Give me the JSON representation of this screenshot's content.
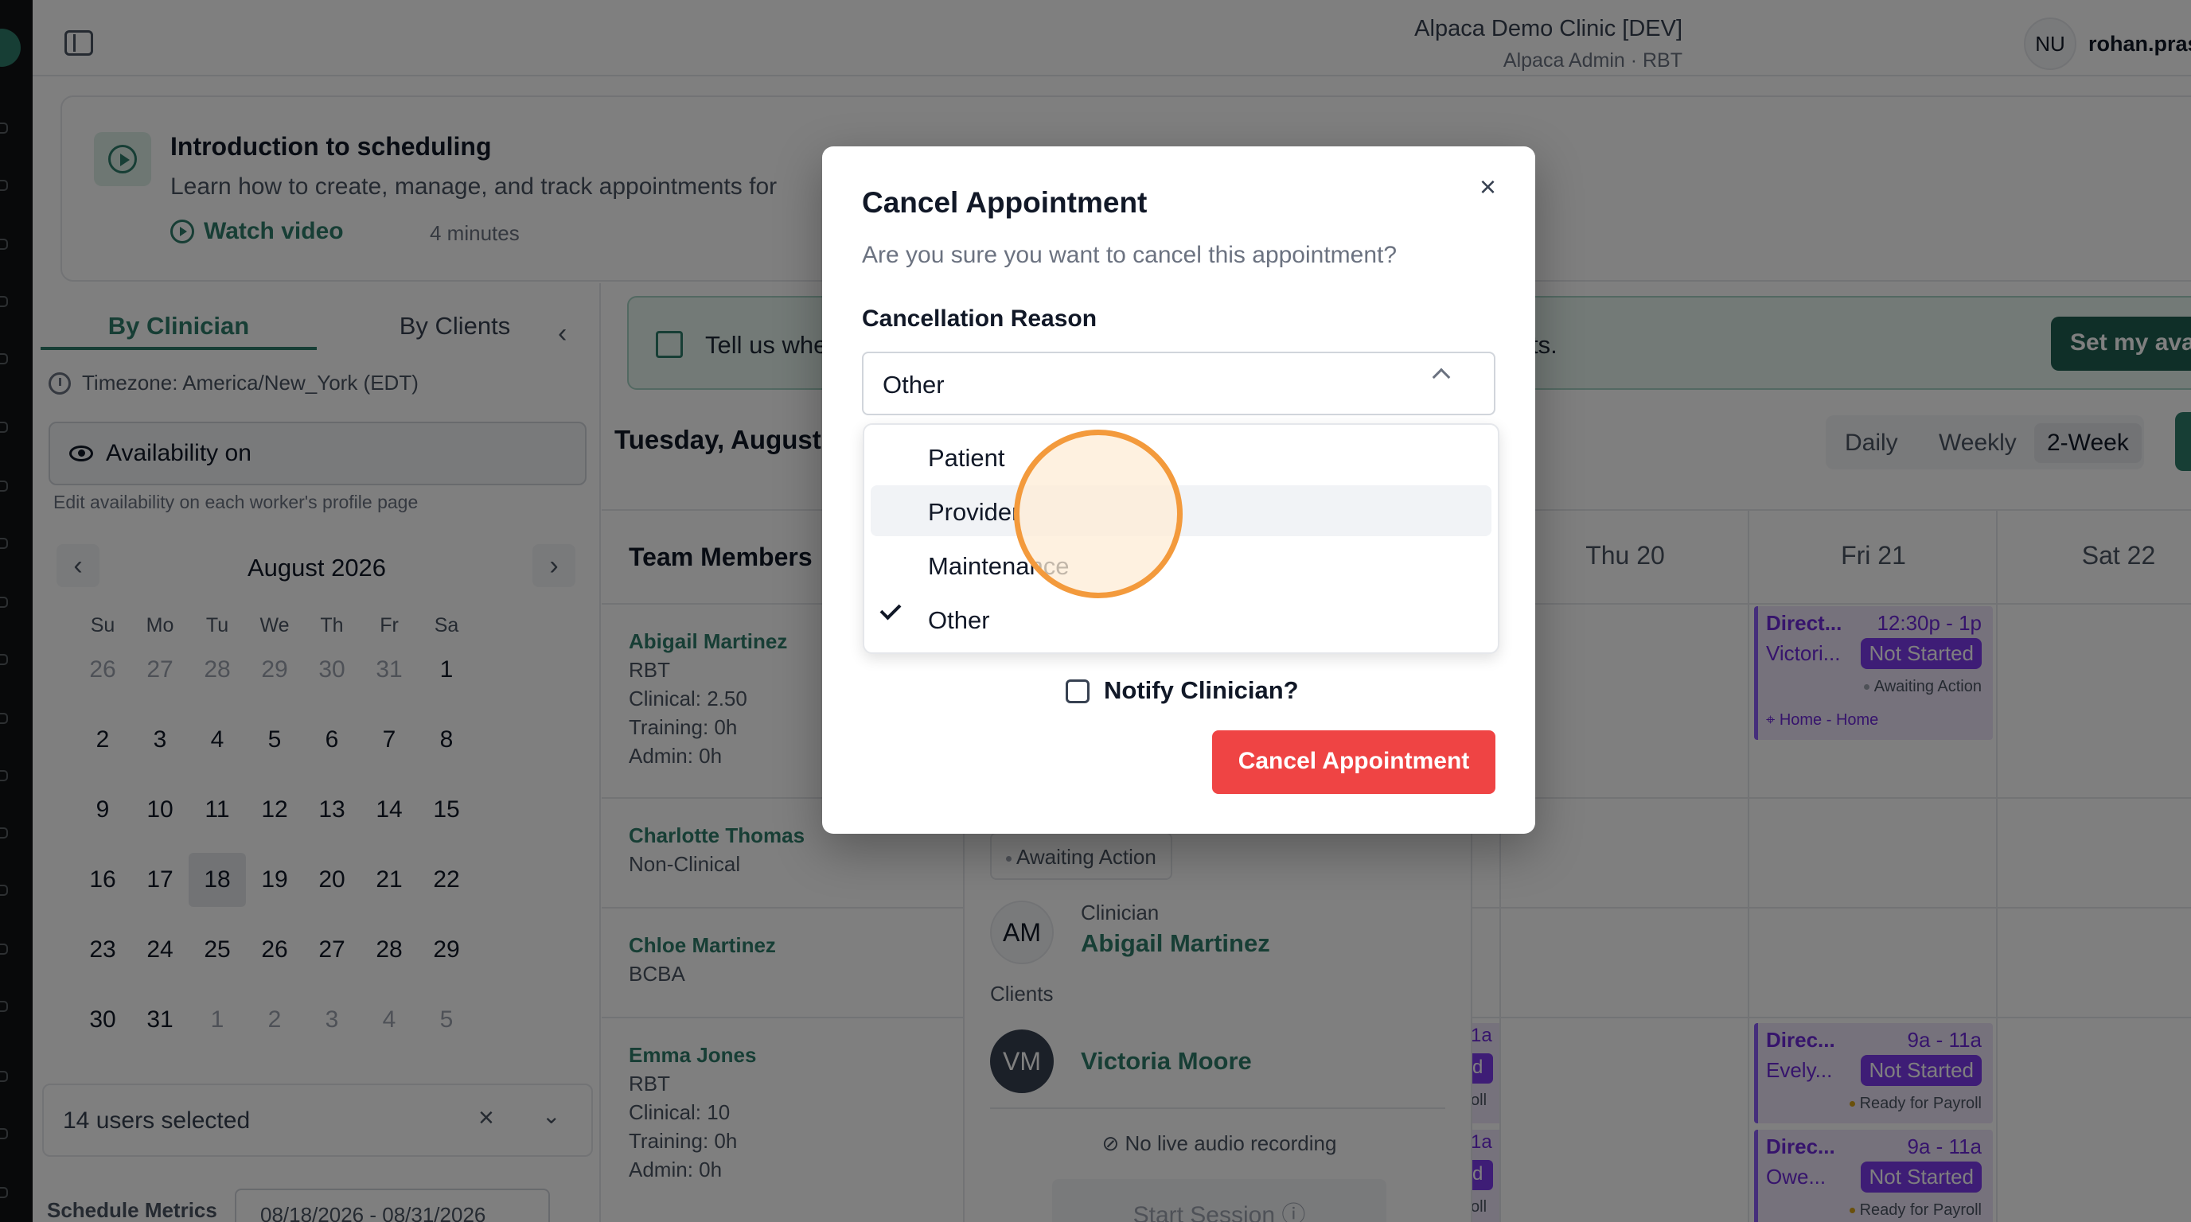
{
  "header": {
    "clinic_name": "Alpaca Demo Clinic [DEV]",
    "clinic_role": "Alpaca Admin · RBT",
    "avatar_initials": "NU",
    "username": "rohan.prashar"
  },
  "intro": {
    "title": "Introduction to scheduling",
    "description": "Learn how to create, manage, and track appointments for",
    "watch_label": "Watch video",
    "duration": "4 minutes"
  },
  "left_panel": {
    "tabs": [
      "By Clinician",
      "By Clients"
    ],
    "collapse_icon": "‹",
    "timezone": "Timezone: America/New_York (EDT)",
    "availability_label": "Availability on",
    "availability_note": "Edit availability on each worker's profile page",
    "calendar": {
      "month": "August 2026",
      "prev": "‹",
      "next": "›",
      "weekdays": [
        "Su",
        "Mo",
        "Tu",
        "We",
        "Th",
        "Fr",
        "Sa"
      ],
      "weeks": [
        [
          "26",
          "27",
          "28",
          "29",
          "30",
          "31",
          "1"
        ],
        [
          "2",
          "3",
          "4",
          "5",
          "6",
          "7",
          "8"
        ],
        [
          "9",
          "10",
          "11",
          "12",
          "13",
          "14",
          "15"
        ],
        [
          "16",
          "17",
          "18",
          "19",
          "20",
          "21",
          "22"
        ],
        [
          "23",
          "24",
          "25",
          "26",
          "27",
          "28",
          "29"
        ],
        [
          "30",
          "31",
          "1",
          "2",
          "3",
          "4",
          "5"
        ]
      ],
      "selected_day": "18"
    },
    "users_selected": "14 users selected",
    "clear_icon": "×",
    "chevron": "⌄",
    "metrics_label": "Schedule Metrics",
    "metrics_range": "08/18/2026 - 08/31/2026"
  },
  "schedule": {
    "banner_text": "Tell us whe",
    "banner_text_tail": "ts.",
    "set_availability": "Set my ava",
    "date_heading": "Tuesday, August",
    "views": [
      "Daily",
      "Weekly",
      "2-Week"
    ],
    "active_view": "2-Week",
    "team_members_header": "Team Members",
    "day_columns": [
      "Thu 20",
      "Fri 21",
      "Sat 22"
    ],
    "members": [
      {
        "name": "Abigail Martinez",
        "lines": [
          "RBT",
          "Clinical: 2.50",
          "Training: 0h",
          "Admin: 0h"
        ]
      },
      {
        "name": "Charlotte Thomas",
        "lines": [
          "Non-Clinical"
        ]
      },
      {
        "name": "Chloe Martinez",
        "lines": [
          "BCBA"
        ]
      },
      {
        "name": "Emma Jones",
        "lines": [
          "RBT",
          "Clinical: 10",
          "Training: 0h",
          "Admin: 0h"
        ]
      }
    ],
    "events": [
      {
        "title": "Direct...",
        "time": "12:30p - 1p",
        "client": "Victori...",
        "badge": "Not Started",
        "status": "Awaiting Action",
        "location": "Home - Home"
      },
      {
        "title": "Direc...",
        "time": "9a - 11a",
        "client": "Evely...",
        "badge": "Not Started",
        "status": "Ready for Payroll"
      },
      {
        "title": "Direc...",
        "time": "9a - 11a",
        "client": "Owe...",
        "badge": "Not Started",
        "status": "Ready for Payroll"
      }
    ],
    "partial_events": [
      "1a",
      "d",
      "oll",
      "1a",
      "d",
      "oll"
    ]
  },
  "popover": {
    "status": "Awaiting Action",
    "clinician_label": "Clinician",
    "clinician_initials": "AM",
    "clinician_name": "Abigail Martinez",
    "clients_label": "Clients",
    "client_initials": "VM",
    "client_name": "Victoria Moore",
    "audio_note": "No live audio recording",
    "start_session": "Start Session ⓘ"
  },
  "modal": {
    "title": "Cancel Appointment",
    "subtitle": "Are you sure you want to cancel this appointment?",
    "reason_label": "Cancellation Reason",
    "selected_reason": "Other",
    "options": [
      "Patient",
      "Provider",
      "Maintenance",
      "Other"
    ],
    "hovered_option": "Provider",
    "notify_label": "Notify Clinician?",
    "cancel_button": "Cancel Appointment",
    "close_icon": "×"
  },
  "colors": {
    "brand": "#2f7d6b",
    "danger": "#ef4444",
    "event_purple": "#7c3aed",
    "click_ring": "#f39a3c"
  }
}
